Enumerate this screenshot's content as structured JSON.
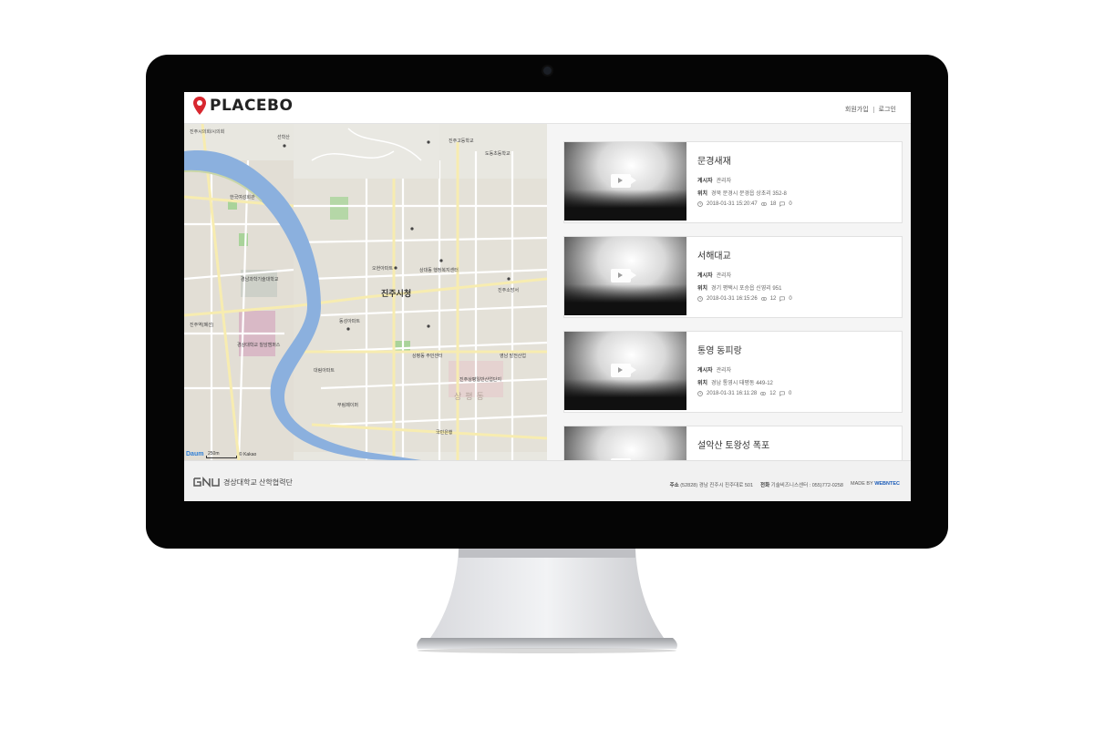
{
  "header": {
    "logo_text": "PLACEBO",
    "signup_label": "회원가입",
    "login_label": "로그인"
  },
  "map": {
    "city_hall_label": "진주시청",
    "district_label": "상평동",
    "scale_label": "250m",
    "copyright": "© Kakao",
    "brand": "Daum",
    "places": [
      "진주시의회/시의회",
      "선학산",
      "진주고등학교",
      "도동초등학교",
      "한국여성회관",
      "경남과학기술대학교",
      "진주역(폐선)",
      "경상대학교 칠암캠퍼스",
      "오현아파트",
      "상대동 행정복지센터",
      "진주소방서",
      "상평동 주민센터",
      "진주상평일반산업단지",
      "대림아파트",
      "무림페이퍼",
      "국민은행",
      "영남 발전산업",
      "동성아파트"
    ]
  },
  "items": [
    {
      "title": "문경새재",
      "author_label": "게시자",
      "author": "관리자",
      "location_label": "위치",
      "location": "경북 문경시 문경읍 상초리 352-8",
      "date": "2018-01-31 15:20:47",
      "views": "18",
      "comments": "0"
    },
    {
      "title": "서해대교",
      "author_label": "게시자",
      "author": "관리자",
      "location_label": "위치",
      "location": "경기 평택시 포승읍 신영리 951",
      "date": "2018-01-31 16:15:26",
      "views": "12",
      "comments": "0"
    },
    {
      "title": "통영 동피랑",
      "author_label": "게시자",
      "author": "관리자",
      "location_label": "위치",
      "location": "경남 통영시 태평동 449-12",
      "date": "2018-01-31 16:11:28",
      "views": "12",
      "comments": "0"
    },
    {
      "title": "설악산 토왕성 폭포"
    }
  ],
  "footer": {
    "org_name": "경상대학교 산학협력단",
    "address_label": "주소",
    "address": "(52828) 경남 진주시 진주대로 501",
    "phone_label": "전화",
    "phone": "기술비즈니스센터 : 055)772-0258",
    "made_by_label": "MADE BY",
    "made_by": "WEBNTEC"
  },
  "colors": {
    "brand_pin": "#d8272f",
    "river": "#8bb0de",
    "map_bg": "#e8e7e0",
    "footer_link": "#1a5bb8"
  }
}
